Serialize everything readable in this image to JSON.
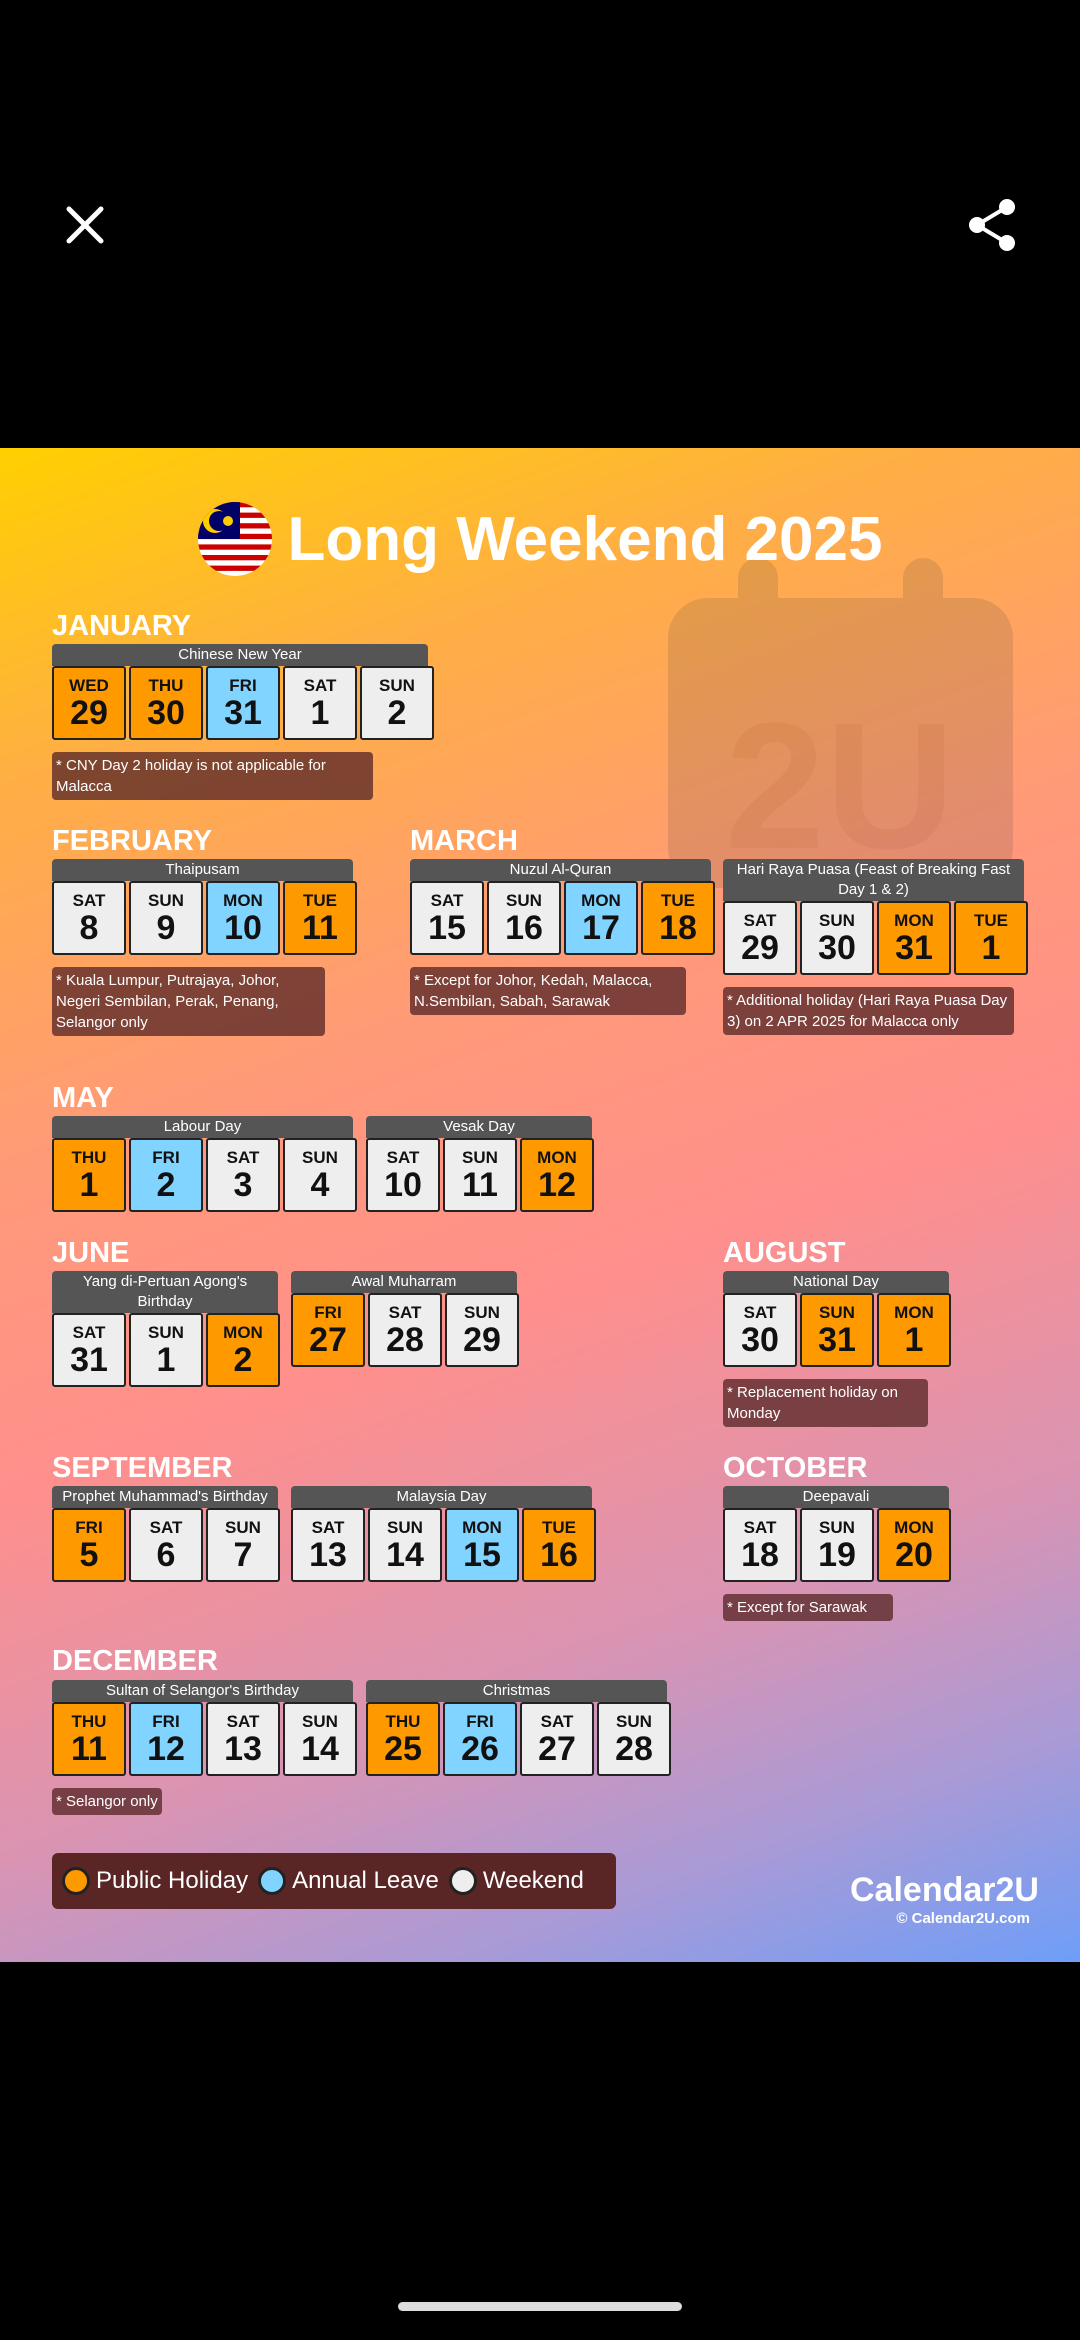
{
  "viewer": {
    "close_icon": "close-icon",
    "share_icon": "share-icon"
  },
  "poster": {
    "title": "Long Weekend 2025",
    "colors": {
      "public_holiday": "#FF9900",
      "annual_leave": "#80D4FF",
      "weekend": "#EEEEEE"
    },
    "months": [
      "JANUARY",
      "FEBRUARY",
      "MARCH",
      "MAY",
      "JUNE",
      "AUGUST",
      "SEPTEMBER",
      "OCTOBER",
      "DECEMBER"
    ],
    "blocks": [
      {
        "header": "Chinese New Year",
        "note": "* CNY Day 2 holiday is not applicable for Malacca",
        "days": [
          {
            "dow": "WED",
            "num": "29",
            "type": "public_holiday"
          },
          {
            "dow": "THU",
            "num": "30",
            "type": "public_holiday"
          },
          {
            "dow": "FRI",
            "num": "31",
            "type": "annual_leave"
          },
          {
            "dow": "SAT",
            "num": "1",
            "type": "weekend"
          },
          {
            "dow": "SUN",
            "num": "2",
            "type": "weekend"
          }
        ]
      },
      {
        "header": "Thaipusam",
        "note": "* Kuala Lumpur, Putrajaya, Johor, Negeri Sembilan, Perak, Penang, Selangor only",
        "days": [
          {
            "dow": "SAT",
            "num": "8",
            "type": "weekend"
          },
          {
            "dow": "SUN",
            "num": "9",
            "type": "weekend"
          },
          {
            "dow": "MON",
            "num": "10",
            "type": "annual_leave"
          },
          {
            "dow": "TUE",
            "num": "11",
            "type": "public_holiday"
          }
        ]
      },
      {
        "header": "Nuzul Al-Quran",
        "note": "* Except for Johor, Kedah, Malacca, N.Sembilan, Sabah, Sarawak",
        "days": [
          {
            "dow": "SAT",
            "num": "15",
            "type": "weekend"
          },
          {
            "dow": "SUN",
            "num": "16",
            "type": "weekend"
          },
          {
            "dow": "MON",
            "num": "17",
            "type": "annual_leave"
          },
          {
            "dow": "TUE",
            "num": "18",
            "type": "public_holiday"
          }
        ]
      },
      {
        "header": "Hari Raya Puasa (Feast of Breaking Fast Day 1 & 2)",
        "note": "* Additional holiday (Hari Raya Puasa Day 3) on 2 APR 2025 for Malacca only",
        "days": [
          {
            "dow": "SAT",
            "num": "29",
            "type": "weekend"
          },
          {
            "dow": "SUN",
            "num": "30",
            "type": "weekend"
          },
          {
            "dow": "MON",
            "num": "31",
            "type": "public_holiday"
          },
          {
            "dow": "TUE",
            "num": "1",
            "type": "public_holiday"
          }
        ]
      },
      {
        "header": "Labour Day",
        "note": "",
        "days": [
          {
            "dow": "THU",
            "num": "1",
            "type": "public_holiday"
          },
          {
            "dow": "FRI",
            "num": "2",
            "type": "annual_leave"
          },
          {
            "dow": "SAT",
            "num": "3",
            "type": "weekend"
          },
          {
            "dow": "SUN",
            "num": "4",
            "type": "weekend"
          }
        ]
      },
      {
        "header": "Vesak Day",
        "note": "",
        "days": [
          {
            "dow": "SAT",
            "num": "10",
            "type": "weekend"
          },
          {
            "dow": "SUN",
            "num": "11",
            "type": "weekend"
          },
          {
            "dow": "MON",
            "num": "12",
            "type": "public_holiday"
          }
        ]
      },
      {
        "header": "Yang di-Pertuan Agong's Birthday",
        "note": "",
        "days": [
          {
            "dow": "SAT",
            "num": "31",
            "type": "weekend"
          },
          {
            "dow": "SUN",
            "num": "1",
            "type": "weekend"
          },
          {
            "dow": "MON",
            "num": "2",
            "type": "public_holiday"
          }
        ]
      },
      {
        "header": "Awal Muharram",
        "note": "",
        "days": [
          {
            "dow": "FRI",
            "num": "27",
            "type": "public_holiday"
          },
          {
            "dow": "SAT",
            "num": "28",
            "type": "weekend"
          },
          {
            "dow": "SUN",
            "num": "29",
            "type": "weekend"
          }
        ]
      },
      {
        "header": "National Day",
        "note": "* Replacement holiday on Monday",
        "days": [
          {
            "dow": "SAT",
            "num": "30",
            "type": "weekend"
          },
          {
            "dow": "SUN",
            "num": "31",
            "type": "public_holiday"
          },
          {
            "dow": "MON",
            "num": "1",
            "type": "public_holiday"
          }
        ]
      },
      {
        "header": "Prophet Muhammad's Birthday",
        "note": "",
        "days": [
          {
            "dow": "FRI",
            "num": "5",
            "type": "public_holiday"
          },
          {
            "dow": "SAT",
            "num": "6",
            "type": "weekend"
          },
          {
            "dow": "SUN",
            "num": "7",
            "type": "weekend"
          }
        ]
      },
      {
        "header": "Malaysia Day",
        "note": "",
        "days": [
          {
            "dow": "SAT",
            "num": "13",
            "type": "weekend"
          },
          {
            "dow": "SUN",
            "num": "14",
            "type": "weekend"
          },
          {
            "dow": "MON",
            "num": "15",
            "type": "annual_leave"
          },
          {
            "dow": "TUE",
            "num": "16",
            "type": "public_holiday"
          }
        ]
      },
      {
        "header": "Deepavali",
        "note": "* Except for Sarawak",
        "days": [
          {
            "dow": "SAT",
            "num": "18",
            "type": "weekend"
          },
          {
            "dow": "SUN",
            "num": "19",
            "type": "weekend"
          },
          {
            "dow": "MON",
            "num": "20",
            "type": "public_holiday"
          }
        ]
      },
      {
        "header": "Sultan of Selangor's Birthday",
        "note": "* Selangor only",
        "days": [
          {
            "dow": "THU",
            "num": "11",
            "type": "public_holiday"
          },
          {
            "dow": "FRI",
            "num": "12",
            "type": "annual_leave"
          },
          {
            "dow": "SAT",
            "num": "13",
            "type": "weekend"
          },
          {
            "dow": "SUN",
            "num": "14",
            "type": "weekend"
          }
        ]
      },
      {
        "header": "Christmas",
        "note": "",
        "days": [
          {
            "dow": "THU",
            "num": "25",
            "type": "public_holiday"
          },
          {
            "dow": "FRI",
            "num": "26",
            "type": "annual_leave"
          },
          {
            "dow": "SAT",
            "num": "27",
            "type": "weekend"
          },
          {
            "dow": "SUN",
            "num": "28",
            "type": "weekend"
          }
        ]
      }
    ],
    "legend": [
      {
        "label": "Public Holiday",
        "type": "public_holiday"
      },
      {
        "label": "Annual Leave",
        "type": "annual_leave"
      },
      {
        "label": "Weekend",
        "type": "weekend"
      }
    ],
    "logo": {
      "name": "Calendar2U",
      "copyright": "© Calendar2U.com"
    }
  }
}
